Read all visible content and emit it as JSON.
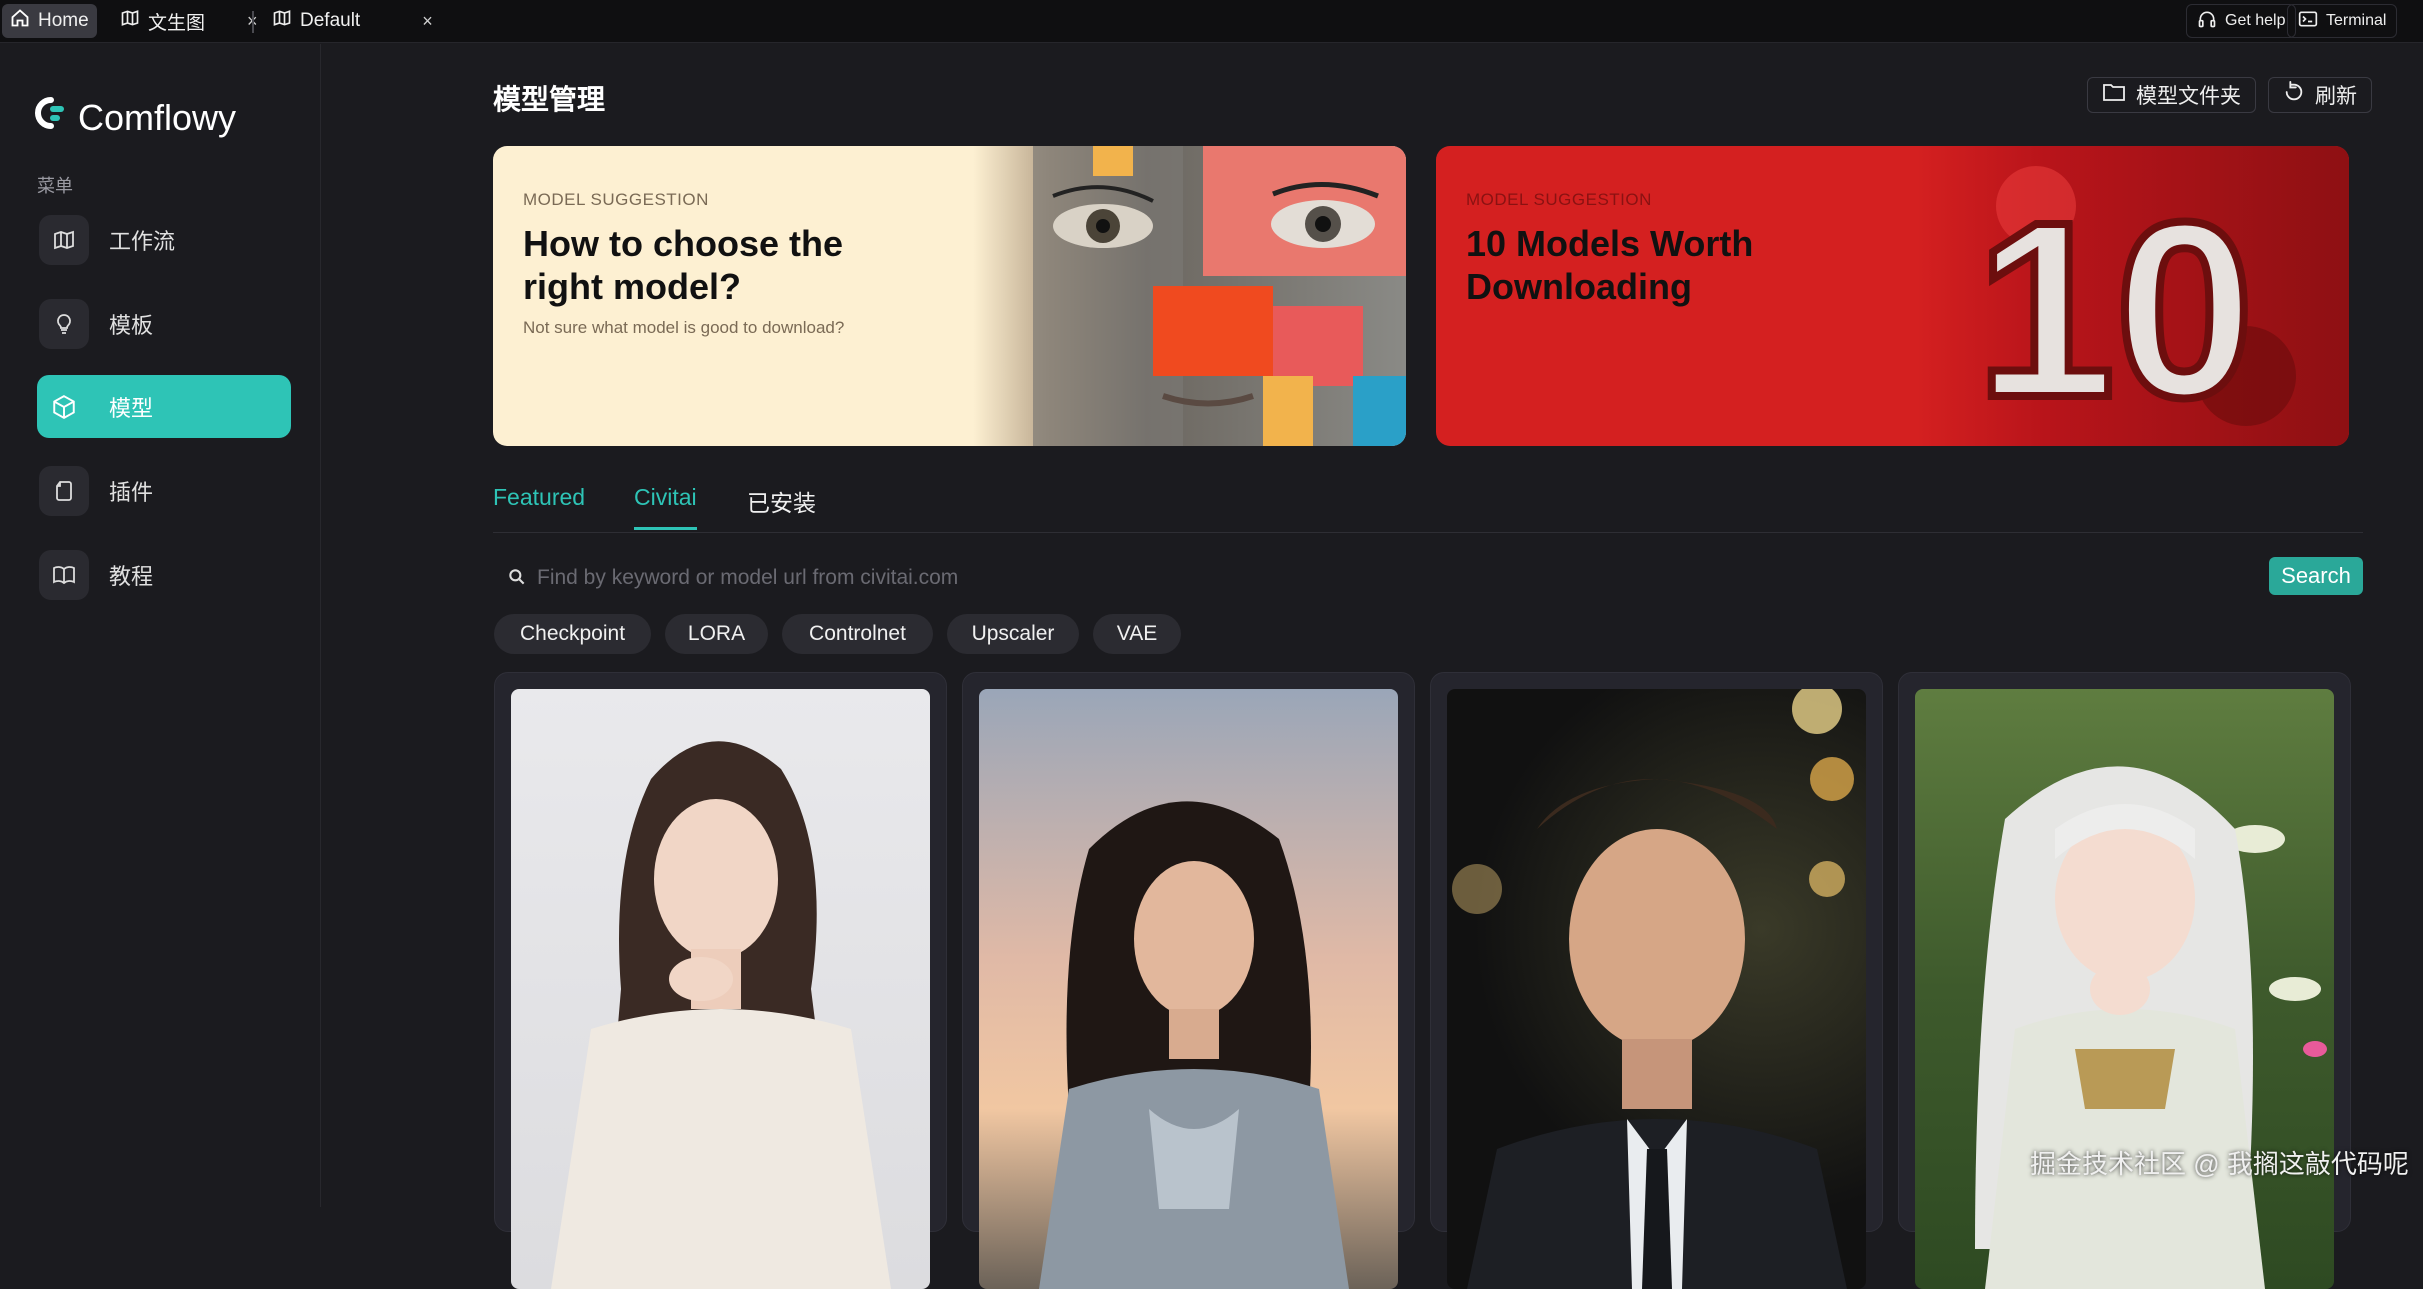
{
  "titlebar": {
    "tabs": [
      {
        "label": "Home",
        "icon": "home-icon"
      },
      {
        "label": "文生图",
        "icon": "map-icon"
      },
      {
        "label": "Default",
        "icon": "map-icon"
      }
    ],
    "close_glyph": "×",
    "get_help": "Get help",
    "terminal": "Terminal"
  },
  "sidebar": {
    "brand": "Comflowy",
    "menu_label": "菜单",
    "items": [
      {
        "label": "工作流",
        "icon": "map-icon"
      },
      {
        "label": "模板",
        "icon": "lightbulb-icon"
      },
      {
        "label": "模型",
        "icon": "cube-icon",
        "active": true
      },
      {
        "label": "插件",
        "icon": "plugin-icon"
      },
      {
        "label": "教程",
        "icon": "book-icon"
      }
    ]
  },
  "main": {
    "title": "模型管理",
    "folder_button": "模型文件夹",
    "refresh_button": "刷新",
    "banners": [
      {
        "tag": "MODEL SUGGESTION",
        "title": "How to choose the right model?",
        "subtitle": "Not sure what model is good to download?"
      },
      {
        "tag": "MODEL SUGGESTION",
        "title": "10 Models Worth Downloading",
        "art_text": "10"
      }
    ],
    "tabs": [
      {
        "label": "Featured"
      },
      {
        "label": "Civitai",
        "active": true
      },
      {
        "label": "已安装"
      }
    ],
    "search": {
      "placeholder": "Find by keyword or model url from civitai.com",
      "value": "",
      "button": "Search"
    },
    "filters": [
      "Checkpoint",
      "LORA",
      "Controlnet",
      "Upscaler",
      "VAE"
    ]
  },
  "watermark": "掘金技术社区 @ 我搁这敲代码呢",
  "colors": {
    "accent": "#2ec4b6",
    "search_button": "#2aa899",
    "banner1_bg": "#fdf0d2",
    "banner2_bg": "#d42020"
  }
}
